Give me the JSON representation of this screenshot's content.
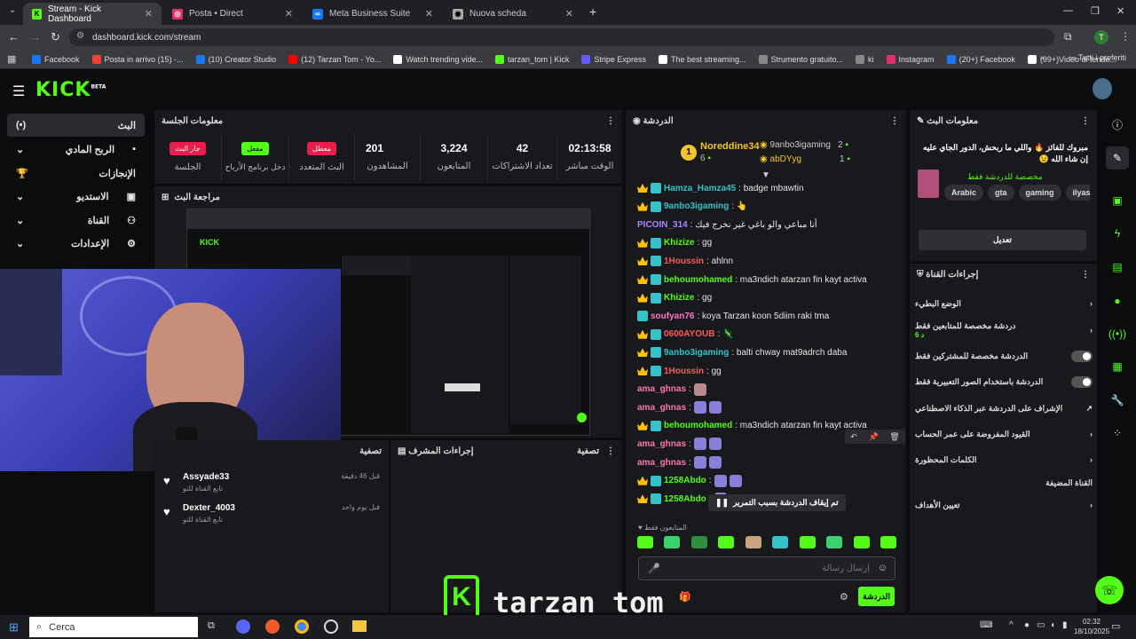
{
  "browser": {
    "tabs": [
      {
        "label": "Stream - Kick Dashboard",
        "color": "#53fc18",
        "glyph": "K"
      },
      {
        "label": "Posta • Direct",
        "color": "#e1306c",
        "glyph": "◎"
      },
      {
        "label": "Meta Business Suite",
        "color": "#1877f2",
        "glyph": "∞"
      },
      {
        "label": "Nuova scheda",
        "color": "#aaaaaa",
        "glyph": "◉"
      }
    ],
    "url": "dashboard.kick.com/stream",
    "profile_initial": "T",
    "bookmarks": [
      {
        "label": "Facebook",
        "color": "#1877f2"
      },
      {
        "label": "Posta in arrivo (15) -...",
        "color": "#ea4335"
      },
      {
        "label": "(10) Creator Studio",
        "color": "#1877f2"
      },
      {
        "label": "(12) Tarzan Tom - Yo...",
        "color": "#ff0000"
      },
      {
        "label": "Watch trending vide...",
        "color": "#ffffff"
      },
      {
        "label": "tarzan_tom | Kick",
        "color": "#53fc18"
      },
      {
        "label": "Stripe Express",
        "color": "#635bff"
      },
      {
        "label": "The best streaming...",
        "color": "#ffffff"
      },
      {
        "label": "Strumento gratuito...",
        "color": "#888888"
      },
      {
        "label": "ki",
        "color": "#888888"
      },
      {
        "label": "Instagram",
        "color": "#e1306c"
      },
      {
        "label": "(20+) Facebook",
        "color": "#1877f2"
      },
      {
        "label": "(99+)Video di tende...",
        "color": "#ffffff"
      }
    ],
    "all_bookmarks": "Tutti i preferiti"
  },
  "kick": {
    "logo": "KICK",
    "beta": "BETA",
    "nav": [
      "البث",
      "الربح المادي",
      "الإنجازات",
      "الاستديو",
      "القناة",
      "الإعدادات"
    ],
    "session": {
      "title": "معلومات الجلسة",
      "badges": [
        {
          "text": "جار البث",
          "label": "الجلسة",
          "color": "#e91e4d"
        },
        {
          "text": "مفعل",
          "label": "دخل برنامج الأرباح",
          "color": "#53fc18"
        },
        {
          "text": "معطل",
          "label": "البث المتعدد",
          "color": "#e91e4d"
        }
      ],
      "stats": [
        {
          "value": "201",
          "label": "المشاهدون"
        },
        {
          "value": "3,224",
          "label": "المتابعون"
        },
        {
          "value": "42",
          "label": "تعداد الاشتراكات"
        },
        {
          "value": "02:13:58",
          "label": "الوقت مباشر"
        }
      ]
    },
    "preview_title": "مراجعة البث",
    "activity": {
      "title": "تصفية",
      "items": [
        {
          "name": "Assyade33",
          "sub": "تابع القناة للتو",
          "time": "قبل 46 دقيقة"
        },
        {
          "name": "Dexter_4003",
          "sub": "تابع القناة للتو",
          "time": "قبل يوم واحد"
        }
      ]
    },
    "mod": {
      "title": "إجراءات المشرف",
      "filter": "تصفية"
    },
    "chat": {
      "title": "الدردشة",
      "top": [
        {
          "name": "Noreddine34",
          "count": "6",
          "rank": "1"
        },
        {
          "name": "9anbo3igaming",
          "count": "2"
        },
        {
          "name": "abDYyg",
          "count": "1"
        }
      ],
      "messages": [
        {
          "user": "Hamza_Hamza45",
          "text": ": badge mbawtin",
          "color": "#35c3c9"
        },
        {
          "user": "9anbo3igaming",
          "text": ": 👆",
          "color": "#35c3c9"
        },
        {
          "user": "PICOIN_314",
          "text": ": أنا مباعي والو باغي غير نخرج فيك",
          "color": "#a987ff"
        },
        {
          "user": "Khizize",
          "text": ": gg",
          "color": "#53fc18"
        },
        {
          "user": "1Houssin",
          "text": ": ahlnn",
          "color": "#ff5a5a"
        },
        {
          "user": "behoumohamed",
          "text": ": ma3ndich atarzan fin kayt activa",
          "color": "#53fc18"
        },
        {
          "user": "Khizize",
          "text": ": gg",
          "color": "#53fc18"
        },
        {
          "user": "soufyan76",
          "text": ": koya Tarzan koon 5diim raki tma",
          "color": "#ff77c8"
        },
        {
          "user": "0600AYOUB",
          "text": ": 🦎",
          "color": "#ff5a5a"
        },
        {
          "user": "9anbo3igaming",
          "text": ": balti chway mat9adrch daba",
          "color": "#35c3c9"
        },
        {
          "user": "1Houssin",
          "text": ": gg",
          "color": "#ff5a5a"
        },
        {
          "user": "ama_ghnas",
          "text": ":",
          "color": "#ff77a8"
        },
        {
          "user": "ama_ghnas",
          "text": ":",
          "color": "#ff77a8"
        },
        {
          "user": "behoumohamed",
          "text": ": ma3ndich atarzan fin kayt activa",
          "color": "#53fc18"
        },
        {
          "user": "ama_ghnas",
          "text": ":",
          "color": "#ff77a8"
        },
        {
          "user": "ama_ghnas",
          "text": ":",
          "color": "#ff77a8"
        },
        {
          "user": "1258Abdo",
          "text": ":",
          "color": "#53fc18"
        },
        {
          "user": "1258Abdo",
          "text": ":",
          "color": "#53fc18"
        }
      ],
      "paused": "تم إيقاف الدردشة بسبب التمرير",
      "followers_only": "المتابعون فقط",
      "placeholder": "إرسال رسالة",
      "send": "الدردشة"
    },
    "stream_info": {
      "title": "معلومات البث",
      "text": "مبروك للفائز 🔥 واللي ما ربحش، الدور الجاي عليه إن شاء الله 😉",
      "category": "مخصصة للدردشة فقط",
      "tags": [
        "Arabic",
        "gta",
        "gaming",
        "ilyaselmaliki"
      ],
      "edit": "تعديل"
    },
    "channel_actions": {
      "title": "إجراءات القناة",
      "items": [
        {
          "label": "الوضع البطيء",
          "kind": "arrow"
        },
        {
          "label": "دردشة مخصصة للمتابعين فقط",
          "sub": "6 د",
          "kind": "arrow"
        },
        {
          "label": "الدردشة مخصصة للمشتركين فقط",
          "kind": "toggle"
        },
        {
          "label": "الدردشة باستخدام الصور التعبيرية فقط",
          "kind": "toggle"
        },
        {
          "label": "الإشراف على الدردشة عبر الذكاء الاصطناعي",
          "kind": "link"
        },
        {
          "label": "القيود المفروضة على عمر الحساب",
          "kind": "arrow"
        },
        {
          "label": "الكلمات المحظورة",
          "kind": "arrow"
        },
        {
          "label": "القناة المضيفة",
          "kind": "none"
        },
        {
          "label": "تعيين الأهداف",
          "kind": "arrow"
        }
      ]
    },
    "overlay_name": "tarzan_tom"
  },
  "taskbar": {
    "search": "Cerca",
    "time": "02:32",
    "date": "18/10/2025"
  }
}
